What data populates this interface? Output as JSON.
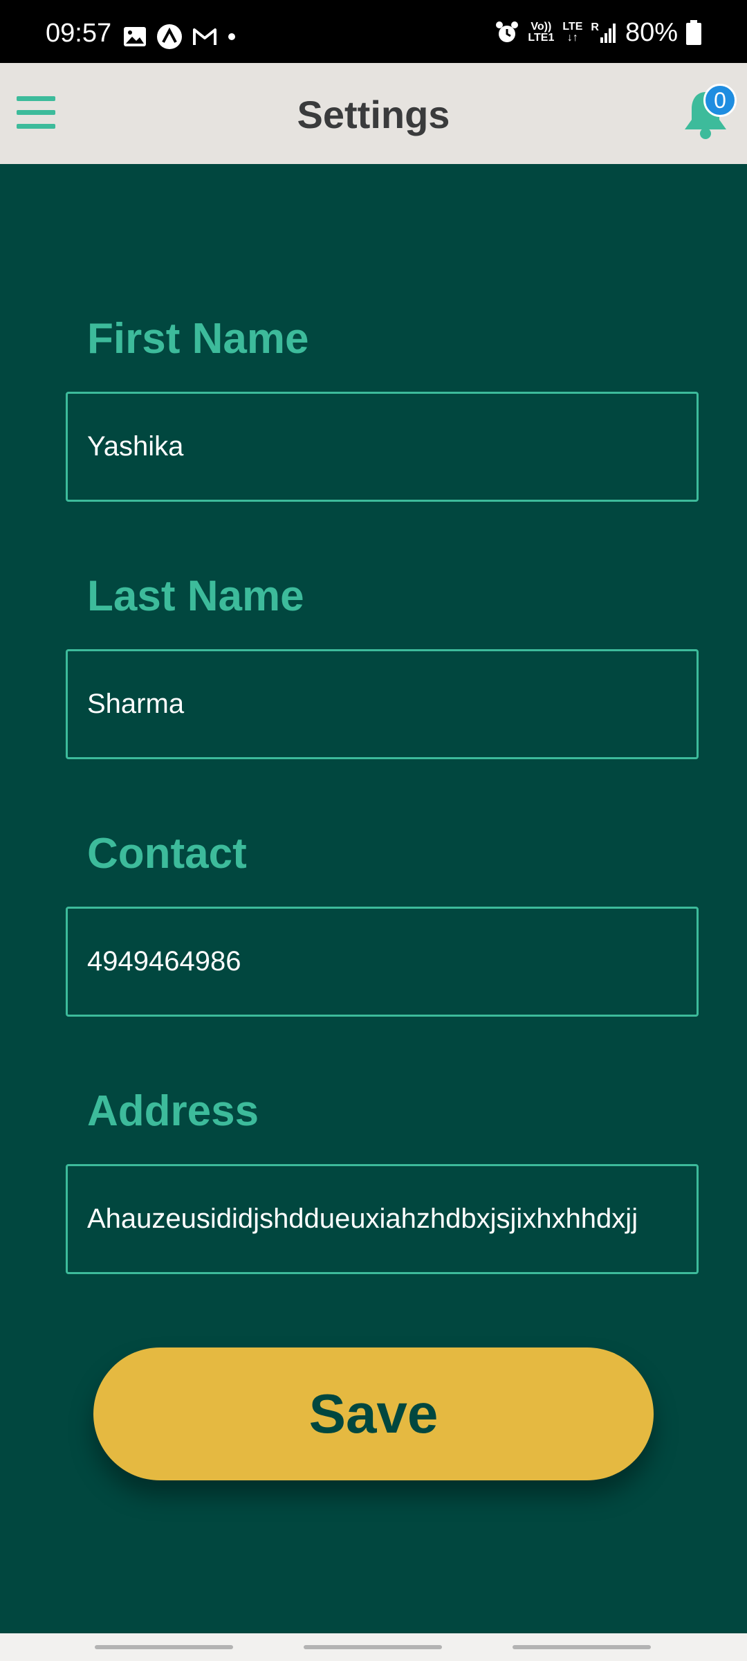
{
  "status_bar": {
    "time": "09:57",
    "network_top": "Vo))",
    "network_bottom": "LTE1",
    "lte_label": "LTE",
    "roaming_label": "R",
    "battery": "80%"
  },
  "app_bar": {
    "title": "Settings",
    "notification_count": "0"
  },
  "form": {
    "first_name": {
      "label": "First Name",
      "value": "Yashika"
    },
    "last_name": {
      "label": "Last Name",
      "value": "Sharma"
    },
    "contact": {
      "label": "Contact",
      "value": "4949464986"
    },
    "address": {
      "label": "Address",
      "value": "Ahauzeusididjshddueuxiahzhdbxjsjixhxhhdxjj"
    },
    "save_label": "Save"
  },
  "colors": {
    "background": "#01473f",
    "accent": "#3dbb9b",
    "button": "#e5b941",
    "app_bar": "#e6e3df",
    "badge": "#1f8de0"
  },
  "icons": [
    "menu-icon",
    "bell-icon",
    "gallery-icon",
    "app-logo-icon",
    "gmail-icon",
    "alarm-icon",
    "signal-icon",
    "battery-icon"
  ]
}
